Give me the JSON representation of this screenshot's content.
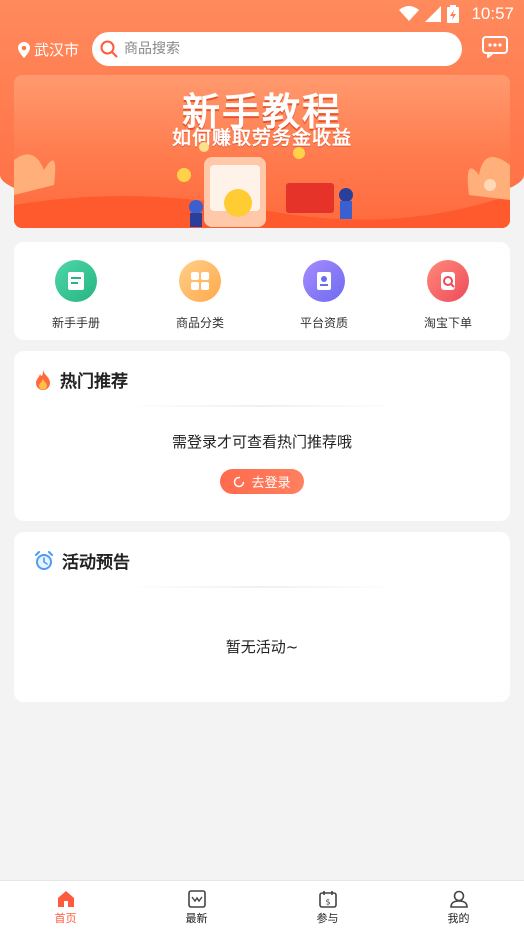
{
  "status_bar": {
    "time": "10:57"
  },
  "header": {
    "city": "武汉市",
    "search_placeholder": "商品搜索"
  },
  "banner": {
    "title": "新手教程",
    "subtitle": "如何赚取劳务金收益"
  },
  "quick_menu": [
    {
      "label": "新手手册",
      "icon": "handbook-icon"
    },
    {
      "label": "商品分类",
      "icon": "category-icon"
    },
    {
      "label": "平台资质",
      "icon": "qualification-icon"
    },
    {
      "label": "淘宝下单",
      "icon": "taobao-order-icon"
    }
  ],
  "hot": {
    "title": "热门推荐",
    "message": "需登录才可查看热门推荐哦",
    "login_label": "去登录"
  },
  "activity": {
    "title": "活动预告",
    "empty": "暂无活动~"
  },
  "bottom_nav": [
    {
      "label": "首页",
      "icon": "home-icon",
      "active": true
    },
    {
      "label": "最新",
      "icon": "latest-icon",
      "active": false
    },
    {
      "label": "参与",
      "icon": "participate-icon",
      "active": false
    },
    {
      "label": "我的",
      "icon": "profile-icon",
      "active": false
    }
  ],
  "colors": {
    "accent": "#ff6a4d",
    "header_bg": "#ff7a4d"
  }
}
